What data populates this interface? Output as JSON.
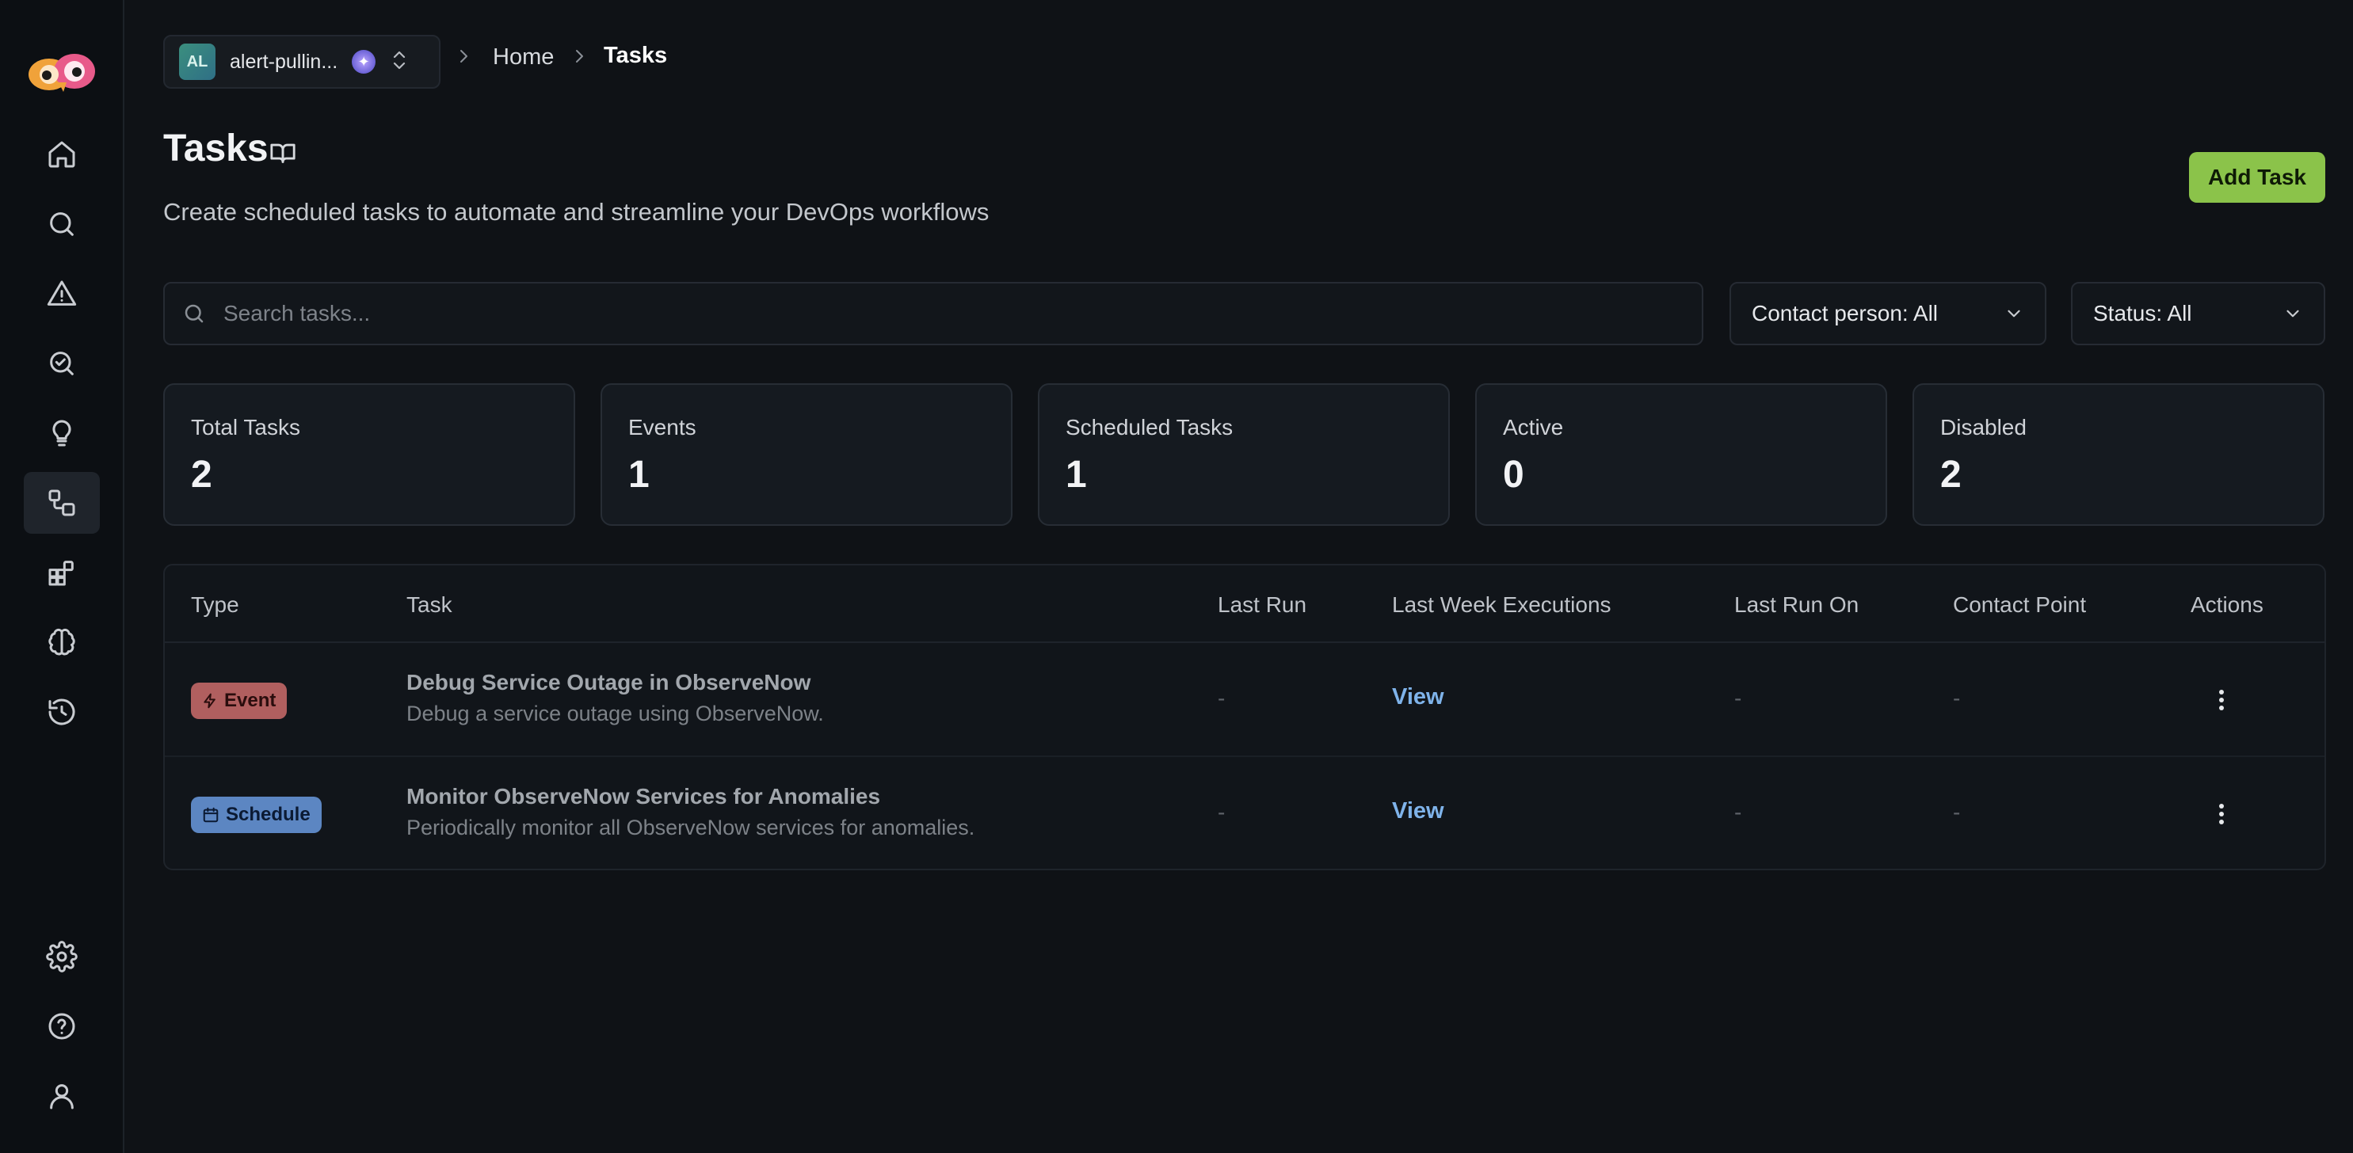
{
  "workspace": {
    "initials": "AL",
    "name": "alert-pullin...",
    "badge": "✦"
  },
  "breadcrumb": {
    "home": "Home",
    "current": "Tasks"
  },
  "header": {
    "title": "Tasks",
    "subtitle": "Create scheduled tasks to automate and streamline your DevOps workflows",
    "add_label": "Add Task"
  },
  "filters": {
    "search_placeholder": "Search tasks...",
    "contact": "Contact person: All",
    "status": "Status: All"
  },
  "stats": [
    {
      "label": "Total Tasks",
      "value": "2"
    },
    {
      "label": "Events",
      "value": "1"
    },
    {
      "label": "Scheduled Tasks",
      "value": "1"
    },
    {
      "label": "Active",
      "value": "0"
    },
    {
      "label": "Disabled",
      "value": "2"
    }
  ],
  "table": {
    "columns": [
      "Type",
      "Task",
      "Last Run",
      "Last Week Executions",
      "Last Run On",
      "Contact Point",
      "Actions"
    ],
    "rows": [
      {
        "type": "Event",
        "title": "Debug Service Outage in ObserveNow",
        "description": "Debug a service outage using ObserveNow.",
        "last_run": "-",
        "executions": "View",
        "last_run_on": "-",
        "contact_point": "-"
      },
      {
        "type": "Schedule",
        "title": "Monitor ObserveNow Services for Anomalies",
        "description": "Periodically monitor all ObserveNow services for anomalies.",
        "last_run": "-",
        "executions": "View",
        "last_run_on": "-",
        "contact_point": "-"
      }
    ]
  },
  "colors": {
    "accent": "#8bc34a",
    "event_badge": "#b05f5f",
    "schedule_badge": "#5c86c2",
    "link": "#7fb3ea"
  },
  "icons": {
    "nav": [
      "home-icon",
      "search-icon",
      "alert-triangle-icon",
      "investigate-icon",
      "lightbulb-icon",
      "tasks-icon",
      "integrations-icon",
      "brain-icon",
      "history-icon",
      "settings-icon",
      "help-icon",
      "user-icon"
    ]
  }
}
